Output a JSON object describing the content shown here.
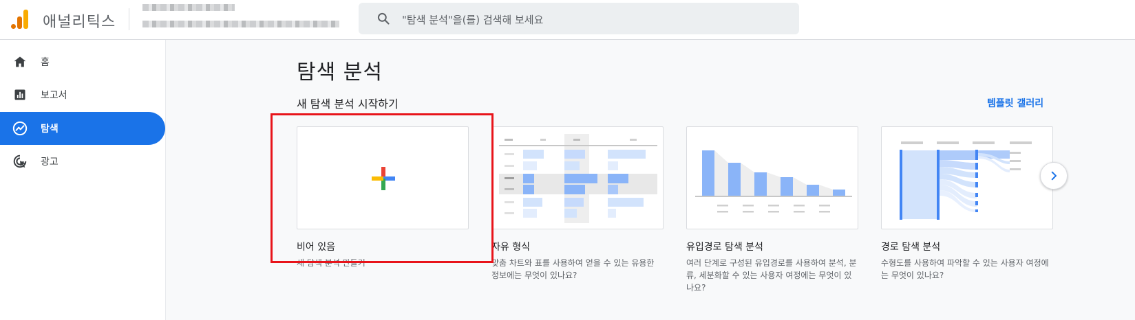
{
  "header": {
    "app_name": "애널리틱스",
    "search_placeholder": "\"탐색 분석\"을(를) 검색해 보세요"
  },
  "sidebar": {
    "items": [
      {
        "label": "홈",
        "icon": "home-icon",
        "active": false
      },
      {
        "label": "보고서",
        "icon": "reports-icon",
        "active": false
      },
      {
        "label": "탐색",
        "icon": "explore-icon",
        "active": true
      },
      {
        "label": "광고",
        "icon": "advertising-icon",
        "active": false
      }
    ]
  },
  "main": {
    "page_title": "탐색 분석",
    "section_title": "새 탐색 분석 시작하기",
    "gallery_link": "템플릿 갤러리",
    "cards": [
      {
        "title": "비어 있음",
        "desc": "새 탐색 분석 만들기"
      },
      {
        "title": "자유 형식",
        "desc": "맞춤 차트와 표를 사용하여 얻을 수 있는 유용한 정보에는 무엇이 있나요?"
      },
      {
        "title": "유입경로 탐색 분석",
        "desc": "여러 단계로 구성된 유입경로를 사용하여 분석, 분류, 세분화할 수 있는 사용자 여정에는 무엇이 있나요?"
      },
      {
        "title": "경로 탐색 분석",
        "desc": "수형도를 사용하여 파악할 수 있는 사용자 여정에는 무엇이 있나요?"
      }
    ]
  },
  "colors": {
    "accent": "#1a73e8",
    "highlight": "#e8141a",
    "thumb_blue": "#8ab4f8",
    "thumb_light_blue": "#d2e3fc"
  }
}
